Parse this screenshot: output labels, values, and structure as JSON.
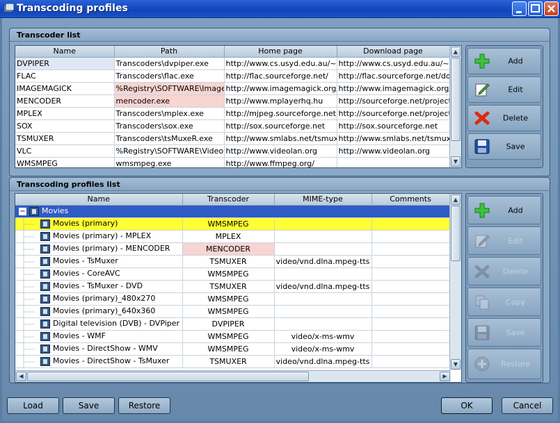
{
  "window": {
    "title": "Transcoding profiles"
  },
  "transcoder_list": {
    "title": "Transcoder list",
    "columns": [
      "Name",
      "Path",
      "Home page",
      "Download page"
    ],
    "rows": [
      [
        "DVPIPER",
        "Transcoders\\dvpiper.exe",
        "http://www.cs.usyd.edu.au/~ef",
        "http://www.cs.usyd.edu.au/~efa"
      ],
      [
        "FLAC",
        "Transcoders\\flac.exe",
        "http://flac.sourceforge.net/",
        "http://flac.sourceforge.net/dowr"
      ],
      [
        "IMAGEMAGICK",
        "%Registry\\SOFTWARE\\ImageM",
        "http://www.imagemagick.org/scr",
        "http://www.imagemagick.org/scr"
      ],
      [
        "MENCODER",
        "mencoder.exe",
        "http://www.mplayerhq.hu",
        "http://sourceforge.net/project/sl"
      ],
      [
        "MPLEX",
        "Transcoders\\mplex.exe",
        "http://mjpeg.sourceforge.net",
        "http://sourceforge.net/projects/i"
      ],
      [
        "SOX",
        "Transcoders\\sox.exe",
        "http://sox.sourceforge.net",
        "http://sox.sourceforge.net"
      ],
      [
        "TSMUXER",
        "Transcoders\\tsMuxeR.exe",
        "http://www.smlabs.net/tsmuxer.",
        "http://www.smlabs.net/tsmuxer."
      ],
      [
        "VLC",
        "%Registry\\SOFTWARE\\VideoLA",
        "http://www.videolan.org",
        "http://www.videolan.org"
      ],
      [
        "WMSMPEG",
        "wmsmpeg.exe",
        "http://www.ffmpeg.org/",
        ""
      ]
    ],
    "buttons": {
      "add": "Add",
      "edit": "Edit",
      "delete": "Delete",
      "save": "Save"
    }
  },
  "profiles_list": {
    "title": "Transcoding profiles list",
    "columns": [
      "Name",
      "Transcoder",
      "MIME-type",
      "Comments"
    ],
    "group_name": "Movies",
    "rows": [
      [
        "Movies (primary)",
        "WMSMPEG",
        "",
        ""
      ],
      [
        "Movies (primary) - MPLEX",
        "MPLEX",
        "",
        ""
      ],
      [
        "Movies (primary) - MENCODER",
        "MENCODER",
        "",
        ""
      ],
      [
        "Movies - TsMuxer",
        "TSMUXER",
        "video/vnd.dlna.mpeg-tts",
        ""
      ],
      [
        "Movies - CoreAVC",
        "WMSMPEG",
        "",
        ""
      ],
      [
        "Movies - TsMuxer - DVD",
        "TSMUXER",
        "video/vnd.dlna.mpeg-tts",
        ""
      ],
      [
        "Movies (primary)_480x270",
        "WMSMPEG",
        "",
        ""
      ],
      [
        "Movies (primary)_640x360",
        "WMSMPEG",
        "",
        ""
      ],
      [
        "Digital television (DVB) - DVPiper",
        "DVPIPER",
        "",
        ""
      ],
      [
        "Movies - WMF",
        "WMSMPEG",
        "video/x-ms-wmv",
        ""
      ],
      [
        "Movies - DirectShow - WMV",
        "WMSMPEG",
        "video/x-ms-wmv",
        ""
      ],
      [
        "Movies - DirectShow - TsMuxer",
        "TSMUXER",
        "video/vnd.dlna.mpeg-tts",
        ""
      ]
    ],
    "buttons": {
      "add": "Add",
      "edit": "Edit",
      "delete": "Delete",
      "copy": "Copy",
      "save": "Save",
      "restore": "Restore"
    }
  },
  "footer": {
    "load": "Load",
    "save": "Save",
    "restore": "Restore",
    "ok": "OK",
    "cancel": "Cancel"
  },
  "colors": {
    "selection": "#2f5bc4",
    "highlight": "#ffff33",
    "error_cell": "#f8d5d2"
  }
}
